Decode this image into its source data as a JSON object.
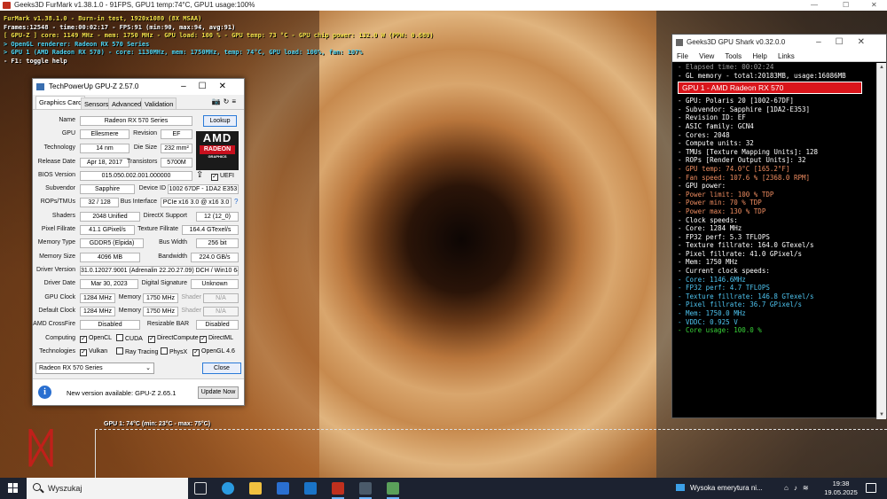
{
  "furmark": {
    "title": "Geeks3D FurMark v1.38.1.0 - 91FPS, GPU1 temp:74°C, GPU1 usage:100%",
    "overlay": [
      {
        "text": "FurMark v1.38.1.0 - Burn-in test, 1920x1080 (8X MSAA)",
        "color": "yellow"
      },
      {
        "text": "Frames:12548 - time:00:02:17 - FPS:91 (min:90, max:94, avg:91)",
        "color": "white"
      },
      {
        "text": "[ GPU-Z ] core: 1149 MHz - mem: 1750 MHz - GPU load: 100 % - GPU temp: 73 °C - GPU chip power: 132.0 W (PPW: 0.689)",
        "color": "yellow"
      },
      {
        "text": "> OpenGL renderer: Radeon RX 570 Series",
        "color": "cyan"
      },
      {
        "text": "> GPU 1 (AMD Radeon RX 570) - core: 1130MHz, mem: 1750MHz, temp: 74°C, GPU load: 100%, fan: 107%",
        "color": "cyan"
      },
      {
        "text": "- F1: toggle help",
        "color": "white"
      }
    ],
    "graph_label": "GPU 1: 74°C (min: 23°C - max: 75°C)"
  },
  "gpuz": {
    "title": "TechPowerUp GPU-Z 2.57.0",
    "tabs": [
      "Graphics Card",
      "Sensors",
      "Advanced",
      "Validation"
    ],
    "active_tab": "Graphics Card",
    "lookup_label": "Lookup",
    "logo": {
      "brand": "AMD",
      "sub": "RADEON",
      "sub2": "GRAPHICS"
    },
    "labels": {
      "name": "Name",
      "gpu": "GPU",
      "revision": "Revision",
      "technology": "Technology",
      "die_size": "Die Size",
      "release_date": "Release Date",
      "transistors": "Transistors",
      "bios": "BIOS Version",
      "uefi": "UEFI",
      "subvendor": "Subvendor",
      "device_id": "Device ID",
      "rops": "ROPs/TMUs",
      "bus": "Bus Interface",
      "shaders": "Shaders",
      "directx": "DirectX Support",
      "pixel": "Pixel Fillrate",
      "texture": "Texture Fillrate",
      "mem_type": "Memory Type",
      "bus_width": "Bus Width",
      "mem_size": "Memory Size",
      "bandwidth": "Bandwidth",
      "driver_version": "Driver Version",
      "driver_date": "Driver Date",
      "digital_sig": "Digital Signature",
      "gpu_clock": "GPU Clock",
      "memory": "Memory",
      "shader": "Shader",
      "default_clock": "Default Clock",
      "crossfire": "AMD CrossFire",
      "rebar": "Resizable BAR",
      "computing": "Computing",
      "technologies": "Technologies"
    },
    "values": {
      "name": "Radeon RX 570 Series",
      "gpu": "Ellesmere",
      "revision": "EF",
      "technology": "14 nm",
      "die_size": "232 mm²",
      "release_date": "Apr 18, 2017",
      "transistors": "5700M",
      "bios": "015.050.002.001.000000",
      "subvendor": "Sapphire",
      "device_id": "1002 67DF - 1DA2 E353",
      "rops": "32 / 128",
      "bus": "PCIe x16 3.0 @ x16 3.0",
      "bus_help": "?",
      "shaders": "2048 Unified",
      "directx": "12 (12_0)",
      "pixel": "41.1 GPixel/s",
      "texture": "164.4 GTexel/s",
      "mem_type": "GDDR5 (Elpida)",
      "bus_width": "256 bit",
      "mem_size": "4096 MB",
      "bandwidth": "224.0 GB/s",
      "driver_version": "31.0.12027.9001 (Adrenalin 22.20.27.09) DCH / Win10 64",
      "driver_date": "Mar 30, 2023",
      "digital_sig": "Unknown",
      "gpu_clock": "1284 MHz",
      "gpu_mem": "1750 MHz",
      "gpu_shader": "N/A",
      "default_clock": "1284 MHz",
      "default_mem": "1750 MHz",
      "default_shader": "N/A",
      "crossfire": "Disabled",
      "rebar": "Disabled"
    },
    "computing": [
      {
        "label": "OpenCL",
        "checked": true
      },
      {
        "label": "CUDA",
        "checked": false
      },
      {
        "label": "DirectCompute",
        "checked": true
      },
      {
        "label": "DirectML",
        "checked": true
      }
    ],
    "technologies": [
      {
        "label": "Vulkan",
        "checked": true
      },
      {
        "label": "Ray Tracing",
        "checked": false
      },
      {
        "label": "PhysX",
        "checked": false
      },
      {
        "label": "OpenGL 4.6",
        "checked": true
      }
    ],
    "selected_card": "Radeon RX 570 Series",
    "close_label": "Close",
    "update_notice": "New version available: GPU-Z 2.65.1",
    "update_button": "Update Now"
  },
  "shark": {
    "title": "Geeks3D GPU Shark v0.32.0.0",
    "menu": [
      "File",
      "View",
      "Tools",
      "Help",
      "Links"
    ],
    "elapsed": "- Elapsed time: 00:02:24",
    "gl_memory": "- GL memory - total:20183MB, usage:16086MB",
    "gpu_header": "GPU 1 - AMD Radeon RX 570",
    "lines": [
      {
        "text": "- GPU: Polaris 20 [1002-67DF]",
        "color": "white"
      },
      {
        "text": "- Subvendor: Sapphire [1DA2-E353]",
        "color": "white"
      },
      {
        "text": "- Revision ID: EF",
        "color": "white"
      },
      {
        "text": "- ASIC family: GCN4",
        "color": "white"
      },
      {
        "text": "- Cores: 2048",
        "color": "white"
      },
      {
        "text": "- Compute units: 32",
        "color": "white"
      },
      {
        "text": "- TMUs [Texture Mapping Units]: 128",
        "color": "white"
      },
      {
        "text": "- ROPs [Render Output Units]: 32",
        "color": "white"
      },
      {
        "text": "- GPU temp: 74.0°C [165.2°F]",
        "color": "orange"
      },
      {
        "text": "- Fan speed: 107.6 % [2368.0 RPM]",
        "color": "orange"
      },
      {
        "text": "- GPU power:",
        "color": "white"
      },
      {
        "text": "  - Power limit: 100 % TDP",
        "color": "orange"
      },
      {
        "text": "  - Power min: 70 % TDP",
        "color": "orange"
      },
      {
        "text": "  - Power max: 130 % TDP",
        "color": "orange"
      },
      {
        "text": "- Clock speeds:",
        "color": "white"
      },
      {
        "text": "  - Core: 1284 MHz",
        "color": "white"
      },
      {
        "text": "  - FP32 perf: 5.3 TFLOPS",
        "color": "white"
      },
      {
        "text": "  - Texture fillrate: 164.0 GTexel/s",
        "color": "white"
      },
      {
        "text": "  - Pixel fillrate: 41.0 GPixel/s",
        "color": "white"
      },
      {
        "text": "  - Mem: 1750 MHz",
        "color": "white"
      },
      {
        "text": "- Current clock speeds:",
        "color": "white"
      },
      {
        "text": "  - Core: 1146.6MHz",
        "color": "cyan"
      },
      {
        "text": "  - FP32 perf: 4.7 TFLOPS",
        "color": "cyan"
      },
      {
        "text": "  - Texture fillrate: 146.8 GTexel/s",
        "color": "cyan"
      },
      {
        "text": "  - Pixel fillrate: 36.7 GPixel/s",
        "color": "cyan"
      },
      {
        "text": "  - Mem: 1750.0 MHz",
        "color": "cyan"
      },
      {
        "text": "  - VDDC: 0.925 V",
        "color": "cyan"
      },
      {
        "text": "- Core usage: 100.0 %",
        "color": "green"
      }
    ]
  },
  "taskbar": {
    "search_placeholder": "Wyszukaj",
    "weather": "Wysoka emerytura ni...",
    "time": "19:38",
    "date": "19.05.2025",
    "icons": [
      "task-view-icon",
      "edge-icon",
      "file-explorer-icon",
      "store-icon",
      "outlook-icon",
      "furmark-icon",
      "gpuz-icon",
      "gpu-shark-icon"
    ],
    "colors": {
      "accent": "#6cb4ff",
      "taskbar": "#1c2230"
    }
  }
}
